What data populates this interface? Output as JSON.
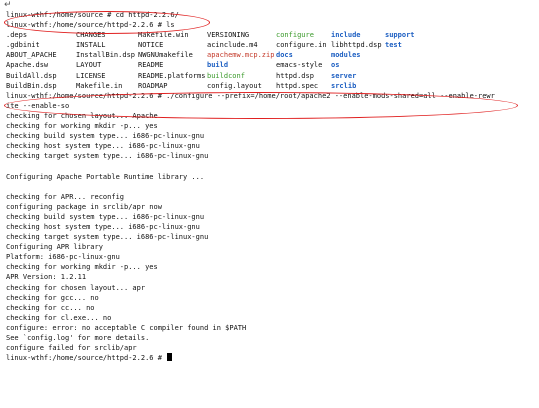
{
  "return_mark": "↵",
  "terminal": {
    "prompt_cd": "linux-wthf:/home/source # cd httpd-2.2.6/",
    "prompt_ls": "linux-wthf:/home/source/httpd-2.2.6 # ls",
    "ls_rows": [
      [
        ".deps",
        "CHANGES",
        "Makefile.win",
        "VERSIONING",
        "configure",
        "include",
        "support"
      ],
      [
        ".gdbinit",
        "INSTALL",
        "NOTICE",
        "acinclude.m4",
        "configure.in",
        "libhttpd.dsp",
        "test"
      ],
      [
        "ABOUT_APACHE",
        "InstallBin.dsp",
        "NWGNUmakefile",
        "apachemw.mcp.zip",
        "docs",
        "modules",
        ""
      ],
      [
        "Apache.dsw",
        "LAYOUT",
        "README",
        "build",
        "emacs-style",
        "os",
        ""
      ],
      [
        "BuildAll.dsp",
        "LICENSE",
        "README.platforms",
        "buildconf",
        "httpd.dsp",
        "server",
        ""
      ],
      [
        "BuildBin.dsp",
        "Makefile.in",
        "ROADMAP",
        "config.layout",
        "httpd.spec",
        "srclib",
        ""
      ]
    ],
    "configure_cmd": "linux-wthf:/home/source/httpd-2.2.6 # ./configure --prefix=/home/root/apache2 --enable-mods-shared=all --enable-rewr",
    "configure_wrap": "ite --enable-so",
    "output": [
      "checking for chosen layout... Apache",
      "checking for working mkdir -p... yes",
      "checking build system type... i686-pc-linux-gnu",
      "checking host system type... i686-pc-linux-gnu",
      "checking target system type... i686-pc-linux-gnu",
      "",
      "Configuring Apache Portable Runtime library ...",
      "",
      "checking for APR... reconfig",
      "configuring package in srclib/apr now",
      "checking build system type... i686-pc-linux-gnu",
      "checking host system type... i686-pc-linux-gnu",
      "checking target system type... i686-pc-linux-gnu",
      "Configuring APR library",
      "Platform: i686-pc-linux-gnu",
      "checking for working mkdir -p... yes",
      "APR Version: 1.2.11",
      "checking for chosen layout... apr",
      "checking for gcc... no",
      "checking for cc... no",
      "checking for cl.exe... no",
      "configure: error: no acceptable C compiler found in $PATH",
      "See `config.log' for more details.",
      "configure failed for srclib/apr"
    ],
    "final_prompt": "linux-wthf:/home/source/httpd-2.2.6 # "
  },
  "colors": {
    "directory": "#1d5fc2",
    "executable": "#3a9a2a",
    "archive": "#c43a2a",
    "annotation_oval": "#e02020"
  },
  "ls_colors": [
    [
      "",
      "",
      "",
      "",
      "green",
      "blue",
      "blue"
    ],
    [
      "",
      "",
      "",
      "",
      "",
      "",
      "blue"
    ],
    [
      "",
      "",
      "",
      "red",
      "blue",
      "blue",
      ""
    ],
    [
      "",
      "",
      "",
      "blue",
      "",
      "blue",
      ""
    ],
    [
      "",
      "",
      "",
      "green",
      "",
      "blue",
      ""
    ],
    [
      "",
      "",
      "",
      "",
      "",
      "blue",
      ""
    ]
  ]
}
